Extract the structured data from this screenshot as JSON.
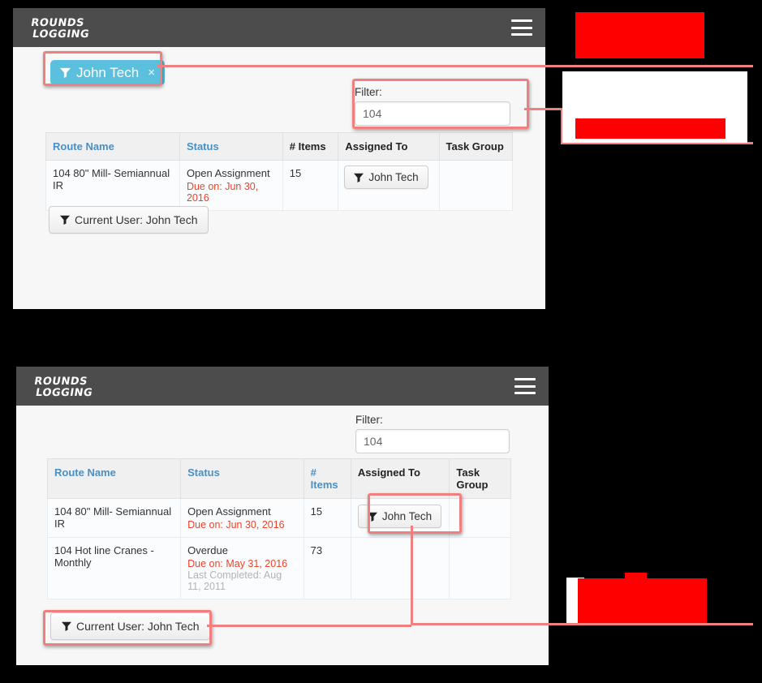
{
  "meta": {
    "background_color": "#000000",
    "accent_chip_color": "#5bc0de",
    "annotation_color": "#f08080",
    "redaction_color": "#ff0000",
    "navbar_color": "#4c4c4c",
    "link_color": "#5b9bc4",
    "due_color": "#e8442c"
  },
  "brand": {
    "line1": "ROUNDS",
    "line2": "LOGGING",
    "logo_name": "rounds-logging-logo"
  },
  "panel_top": {
    "chip": {
      "label": "John Tech",
      "close_label": "×",
      "icon": "funnel-icon"
    },
    "filter": {
      "label": "Filter:",
      "value": "104",
      "placeholder": ""
    },
    "table": {
      "headers": [
        {
          "label": "Route Name",
          "sortable": true
        },
        {
          "label": "Status",
          "sortable": true
        },
        {
          "label": "# Items",
          "sortable": false
        },
        {
          "label": "Assigned To",
          "sortable": false
        },
        {
          "label": "Task Group",
          "sortable": false
        }
      ],
      "rows": [
        {
          "route_name": "104 80\" Mill- Semiannual IR",
          "status_main": "Open Assignment",
          "status_due": "Due on: Jun 30, 2016",
          "status_last": "",
          "items": "15",
          "assigned_to": "John Tech",
          "assigned_icon": "funnel-icon",
          "task_group": ""
        }
      ]
    },
    "current_user_button": {
      "label": "Current User: John Tech",
      "icon": "funnel-icon"
    },
    "hamburger": "hamburger-menu-icon"
  },
  "panel_bottom": {
    "filter": {
      "label": "Filter:",
      "value": "104",
      "placeholder": ""
    },
    "table": {
      "headers": [
        {
          "label": "Route Name",
          "sortable": true
        },
        {
          "label": "Status",
          "sortable": true
        },
        {
          "label": "# Items",
          "sortable": true
        },
        {
          "label": "Assigned To",
          "sortable": false
        },
        {
          "label": "Task Group",
          "sortable": false
        }
      ],
      "rows": [
        {
          "route_name": "104 80\" Mill- Semiannual IR",
          "status_main": "Open Assignment",
          "status_due": "Due on: Jun 30, 2016",
          "status_last": "",
          "items": "15",
          "assigned_to": "John Tech",
          "assigned_icon": "funnel-icon",
          "task_group": ""
        },
        {
          "route_name": "104 Hot line Cranes - Monthly",
          "status_main": "Overdue",
          "status_due": "Due on: May 31, 2016",
          "status_last": "Last Completed: Aug 11, 2011",
          "items": "73",
          "assigned_to": "",
          "assigned_icon": "",
          "task_group": ""
        }
      ]
    },
    "current_user_button": {
      "label": "Current User: John Tech",
      "icon": "funnel-icon"
    },
    "hamburger": "hamburger-menu-icon"
  },
  "annotations": {
    "redaction_blocks": 3,
    "note": "Red redaction blocks cover callout text on the right margin"
  }
}
